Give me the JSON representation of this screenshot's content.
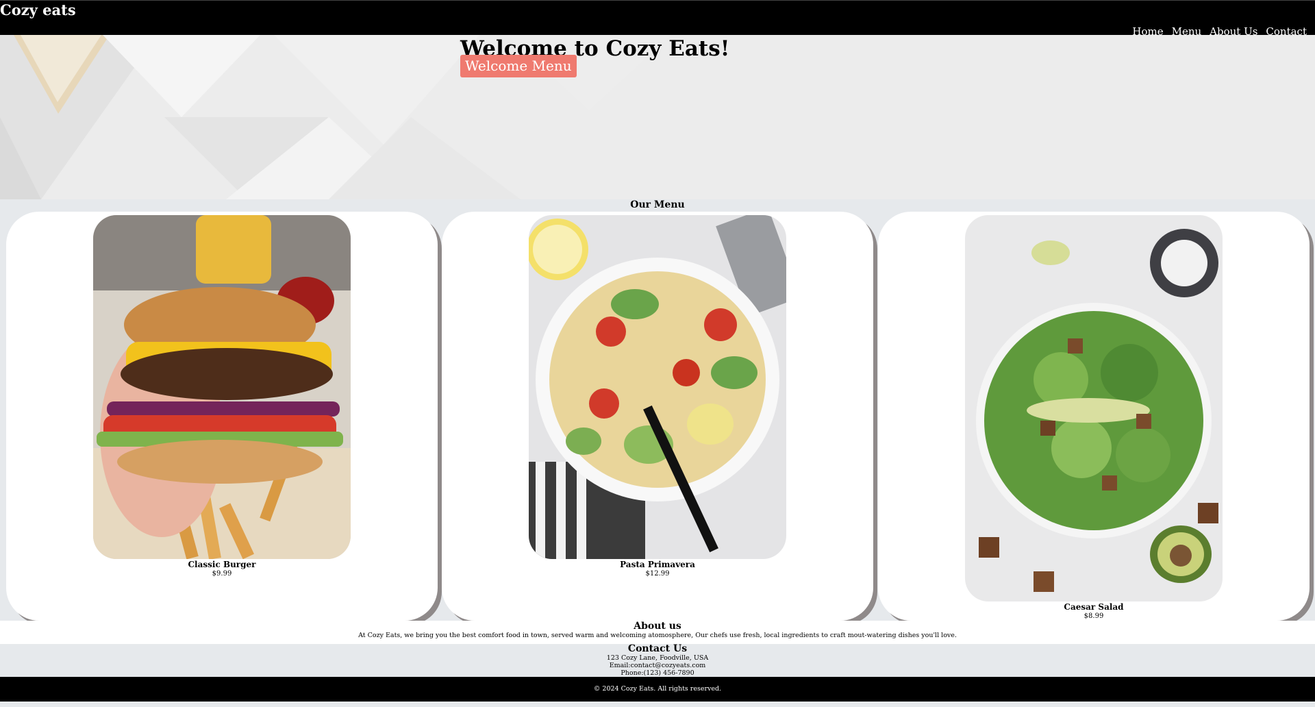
{
  "header": {
    "brand": "Cozy eats",
    "nav": [
      "Home",
      "Menu",
      "About Us",
      "Contact"
    ]
  },
  "hero": {
    "title": "Welcome to Cozy Eats!",
    "button_label": "Welcome Menu"
  },
  "menu": {
    "title": "Our Menu",
    "items": [
      {
        "name": "Classic Burger",
        "price": "$9.99"
      },
      {
        "name": "Pasta Primavera",
        "price": "$12.99"
      },
      {
        "name": "Caesar Salad",
        "price": "$8.99"
      }
    ]
  },
  "about": {
    "title": "About us",
    "text": "At Cozy Eats, we bring you the best comfort food in town, served warm and welcoming atomosphere, Our chefs use fresh, local ingredients to craft mout-watering dishes you'll love."
  },
  "contact": {
    "title": "Contact Us",
    "address": "123 Cozy Lane, Foodville, USA",
    "email": "Email:contact@cozyeats.com",
    "phone": "Phone:(123) 456-7890"
  },
  "footer": {
    "text": "© 2024 Cozy Eats. All rights reserved."
  },
  "colors": {
    "header_bg": "#000000",
    "button_bg": "#ef7a6f",
    "page_bg": "#e6e9ec",
    "card_shadow": "#8f8a8a"
  }
}
